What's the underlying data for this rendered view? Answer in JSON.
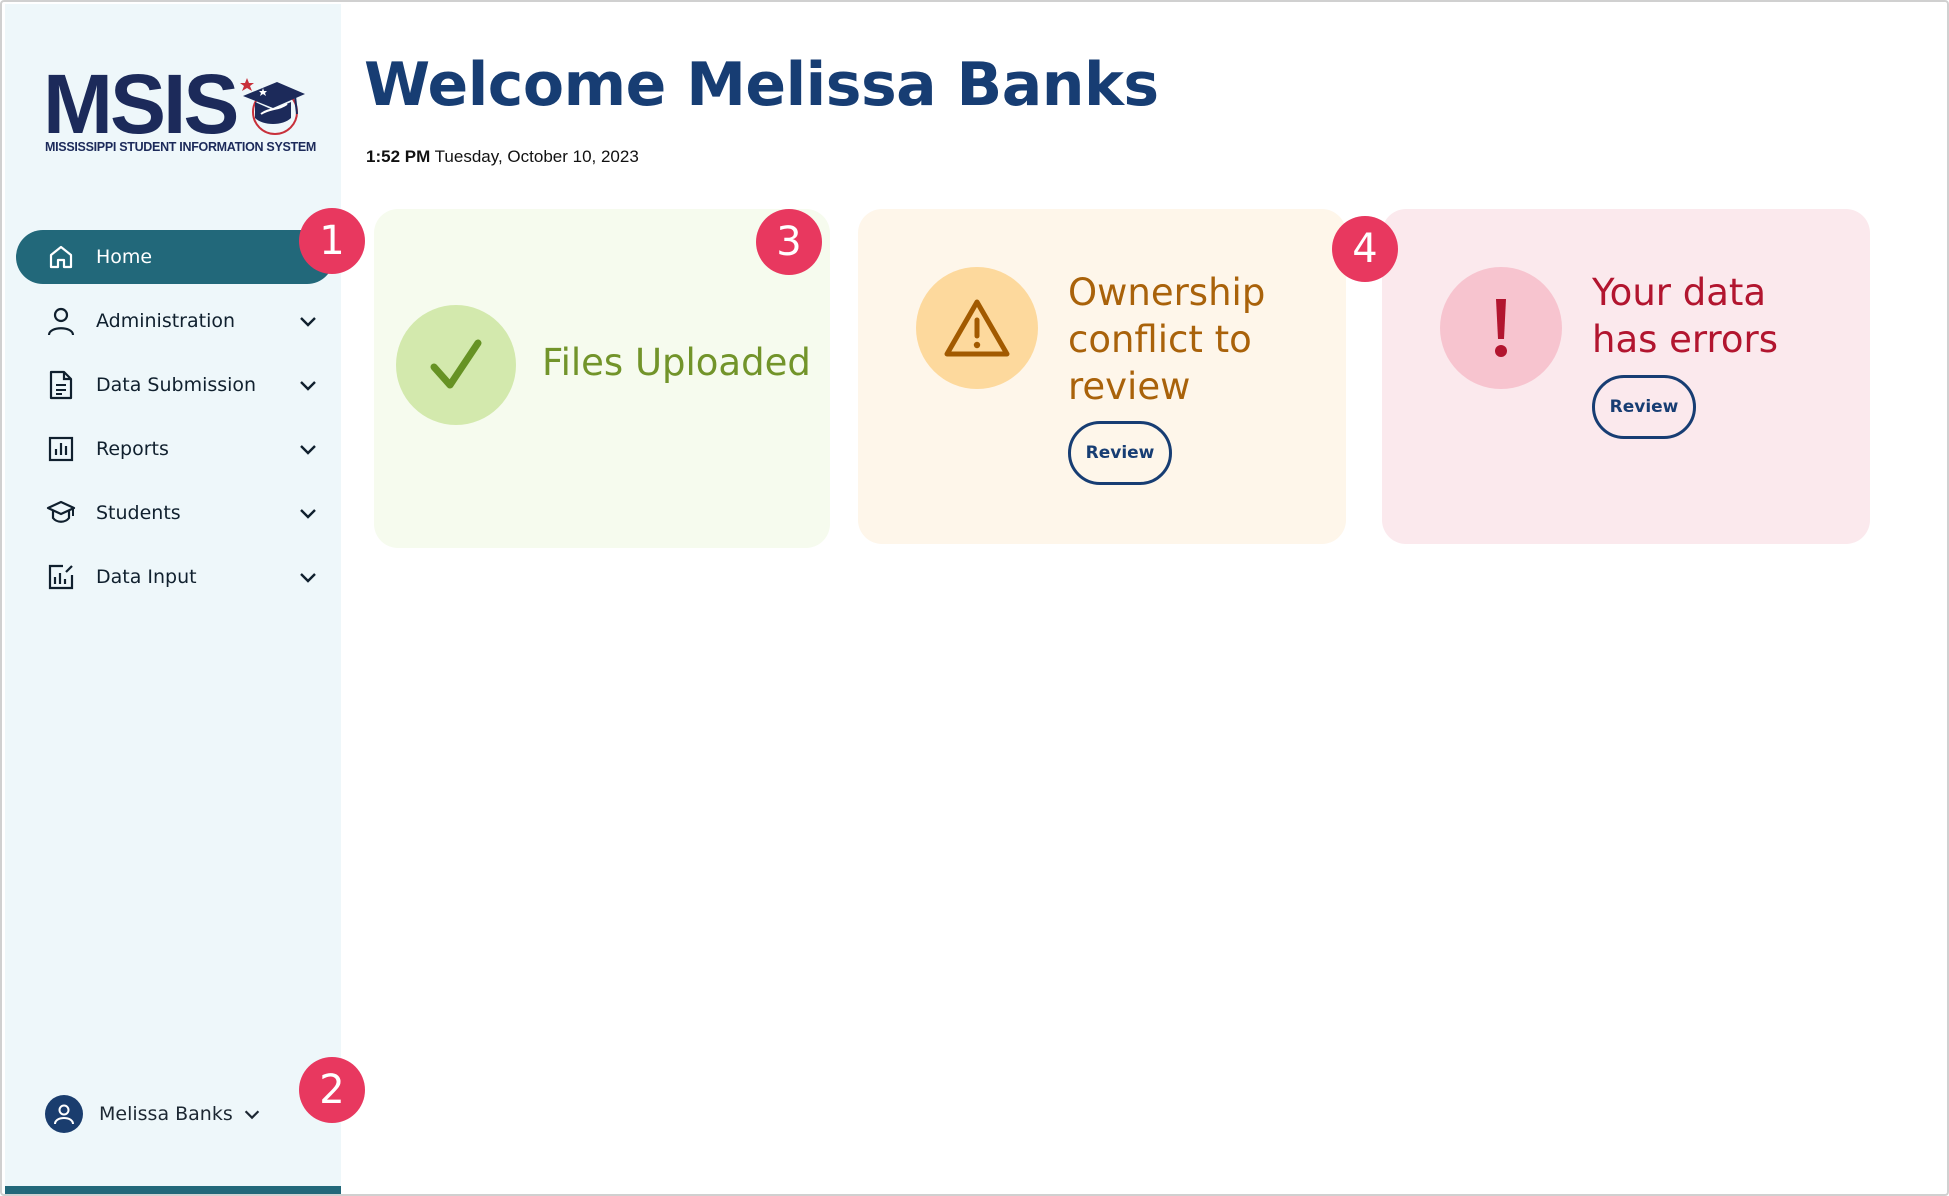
{
  "brand": {
    "logo_text": "MSIS",
    "logo_subtitle": "MISSISSIPPI STUDENT INFORMATION SYSTEM"
  },
  "sidebar": {
    "items": [
      {
        "label": "Home",
        "icon": "home-icon",
        "active": true
      },
      {
        "label": "Administration",
        "icon": "user-icon",
        "active": false
      },
      {
        "label": "Data Submission",
        "icon": "document-icon",
        "active": false
      },
      {
        "label": "Reports",
        "icon": "bar-chart-icon",
        "active": false
      },
      {
        "label": "Students",
        "icon": "graduation-cap-icon",
        "active": false
      },
      {
        "label": "Data Input",
        "icon": "data-input-icon",
        "active": false
      }
    ],
    "user": {
      "name": "Melissa Banks",
      "icon": "user-avatar-icon"
    }
  },
  "header": {
    "welcome": "Welcome Melissa Banks",
    "time": "1:52 PM",
    "date": "Tuesday, October 10, 2023"
  },
  "cards": {
    "uploaded": {
      "text": "Files Uploaded",
      "icon": "checkmark-icon"
    },
    "ownership": {
      "text": "Ownership conflict to review",
      "button": "Review",
      "icon": "warning-triangle-icon"
    },
    "errors": {
      "text": "Your data has errors",
      "button": "Review",
      "icon": "exclamation-icon"
    }
  },
  "badges": [
    "1",
    "2",
    "3",
    "4"
  ],
  "colors": {
    "sidebar_bg": "#eef7fa",
    "nav_active": "#22687a",
    "heading": "#173d73",
    "badge": "#e8385f",
    "success": "#72942a",
    "warning": "#a9620a",
    "error": "#b2152f"
  }
}
